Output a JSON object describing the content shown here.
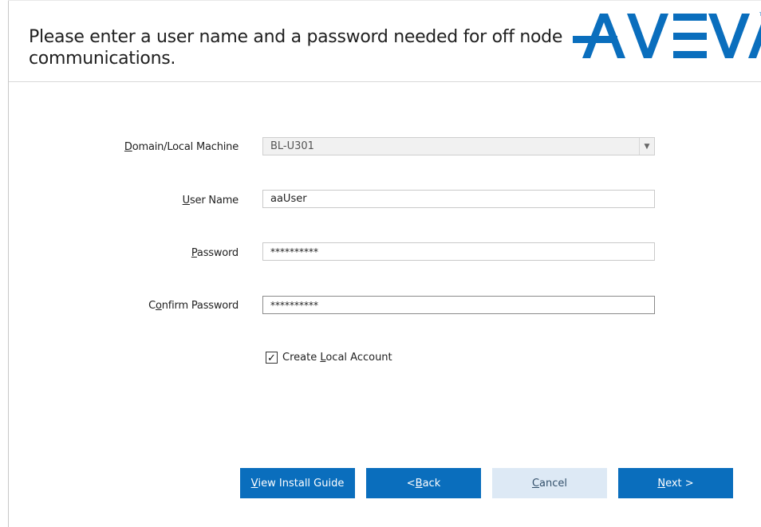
{
  "header": {
    "instruction": "Please enter a user name and a password needed for off node communications.",
    "logo_text": "AVEVA"
  },
  "form": {
    "domain": {
      "label_accel": "D",
      "label_rest": "omain/Local Machine",
      "value": "BL-U301"
    },
    "user_name": {
      "label_accel": "U",
      "label_rest": "ser Name",
      "value": "aaUser"
    },
    "password": {
      "label_accel": "P",
      "label_rest": "assword",
      "value": "**********"
    },
    "confirm_password": {
      "label_pre": "C",
      "label_accel": "o",
      "label_rest": "nfirm Password",
      "value": "**********"
    },
    "create_local_account": {
      "checked": true,
      "check_glyph": "✓",
      "label_pre": "Create ",
      "label_accel": "L",
      "label_rest": "ocal Account"
    }
  },
  "buttons": {
    "view_install_guide": {
      "accel": "V",
      "rest": "iew Install Guide"
    },
    "back": {
      "pre": "< ",
      "accel": "B",
      "rest": "ack"
    },
    "cancel": {
      "accel": "C",
      "rest": "ancel"
    },
    "next": {
      "accel": "N",
      "rest": "ext >"
    }
  },
  "colors": {
    "primary": "#0a6ebd",
    "disabled_button": "#dde9f5",
    "logo": "#0a6ebd"
  }
}
